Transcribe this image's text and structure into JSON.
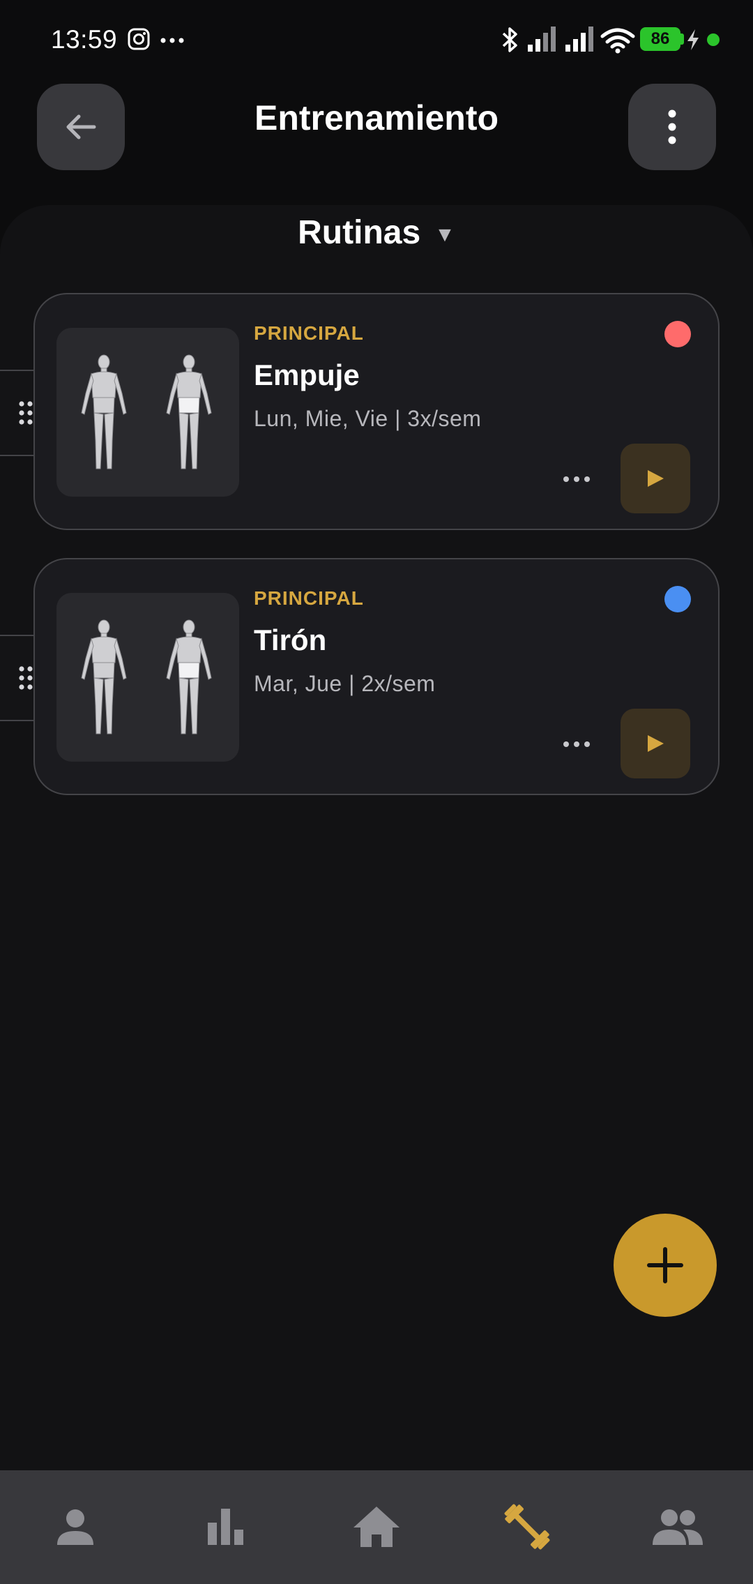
{
  "status_bar": {
    "time": "13:59",
    "battery_level": "86",
    "icons": [
      "instagram-icon",
      "more-notifications-icon",
      "bluetooth-icon",
      "signal-icon",
      "signal-icon",
      "wifi-icon",
      "battery-icon",
      "charging-icon",
      "status-dot"
    ]
  },
  "header": {
    "title": "Entrenamiento",
    "back_icon": "arrow-left-icon",
    "more_icon": "more-vertical-icon"
  },
  "selector": {
    "label": "Rutinas",
    "caret": "▼"
  },
  "routines": [
    {
      "tag": "PRINCIPAL",
      "name": "Empuje",
      "schedule": "Lun, Mie, Vie | 3x/sem",
      "color": "#ff6b6b",
      "menu_icon": "more-horizontal-icon",
      "play_icon": "play-icon"
    },
    {
      "tag": "PRINCIPAL",
      "name": "Tirón",
      "schedule": "Mar, Jue | 2x/sem",
      "color": "#4a8ff2",
      "menu_icon": "more-horizontal-icon",
      "play_icon": "play-icon"
    }
  ],
  "fab": {
    "icon": "plus-icon"
  },
  "bottom_nav": {
    "items": [
      {
        "icon": "person-icon",
        "active": false
      },
      {
        "icon": "bar-chart-icon",
        "active": false
      },
      {
        "icon": "home-icon",
        "active": false
      },
      {
        "icon": "dumbbell-icon",
        "active": true
      },
      {
        "icon": "group-icon",
        "active": false
      }
    ]
  },
  "colors": {
    "accent": "#c9992c",
    "accent_text": "#d6a740",
    "background": "#0c0c0d",
    "surface": "#1b1b1f",
    "nav_inactive": "#8e8e93"
  }
}
